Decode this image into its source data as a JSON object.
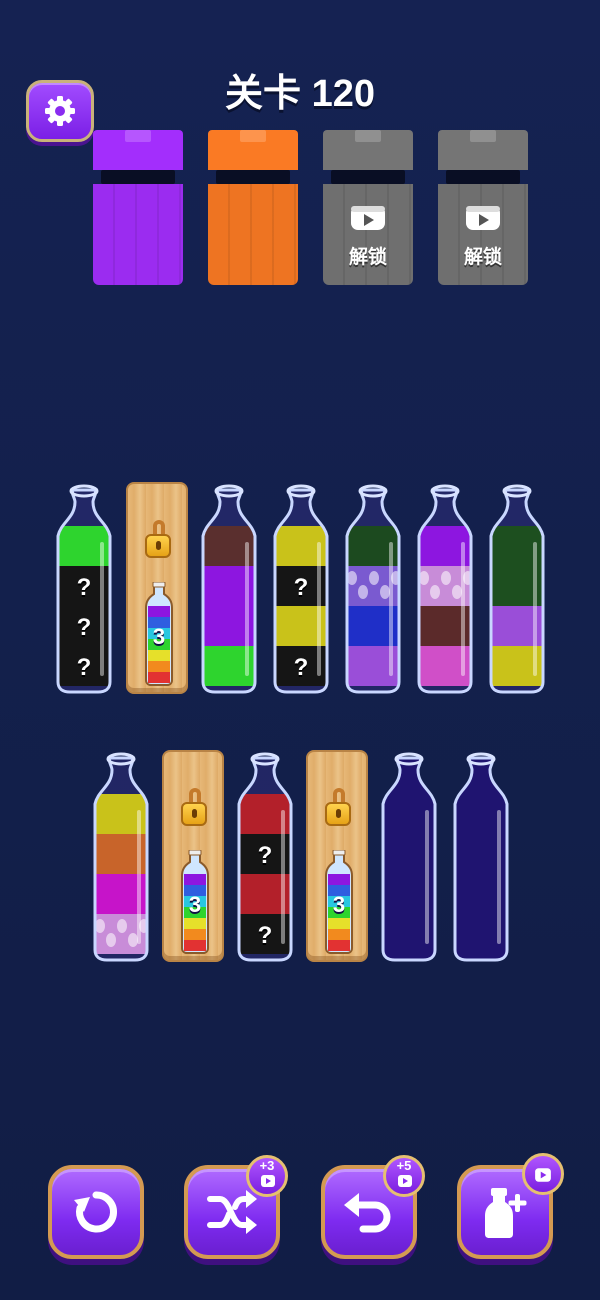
{
  "level": {
    "title": "关卡 120"
  },
  "settings": {
    "icon": "gear-icon"
  },
  "boxes": [
    {
      "color": "#9b2cf0",
      "locked": false
    },
    {
      "color": "#ee7422",
      "locked": false
    },
    {
      "color": "#6f6f6f",
      "locked": true,
      "label": "解锁",
      "icon": "video-icon"
    },
    {
      "color": "#6f6f6f",
      "locked": true,
      "label": "解锁",
      "icon": "video-icon"
    }
  ],
  "colors": {
    "green": "#2ed42e",
    "black": "#151515",
    "brown": "#5a2f2e",
    "purple": "#8d16e0",
    "yellow": "#c9c21a",
    "darkgreen": "#1c4a1f",
    "blue": "#1f2fc8",
    "lavender": "#9a4ed8",
    "pink": "#d04fc8",
    "maroon": "#5b2a2a",
    "olivegreen": "#1d4f1f",
    "orange": "#c8642a",
    "magenta": "#c614c9",
    "red": "#b3202a",
    "marbleblue": "#7a5ad0",
    "marblepink": "#c88cd8"
  },
  "row1": [
    {
      "type": "bottle",
      "layers": [
        "green",
        "black",
        "black",
        "black"
      ],
      "hidden": [
        false,
        true,
        true,
        true
      ]
    },
    {
      "type": "locked",
      "count": "3"
    },
    {
      "type": "bottle",
      "layers": [
        "brown",
        "purple",
        "purple",
        "green"
      ],
      "hidden": [
        false,
        false,
        false,
        false
      ]
    },
    {
      "type": "bottle",
      "layers": [
        "yellow",
        "black",
        "yellow",
        "black"
      ],
      "hidden": [
        false,
        true,
        false,
        true
      ]
    },
    {
      "type": "bottle",
      "layers": [
        "darkgreen",
        "marbleblue",
        "blue",
        "lavender"
      ],
      "hidden": [
        false,
        false,
        false,
        false
      ]
    },
    {
      "type": "bottle",
      "layers": [
        "purple",
        "marblepink",
        "maroon",
        "pink"
      ],
      "hidden": [
        false,
        false,
        false,
        false
      ]
    },
    {
      "type": "bottle",
      "layers": [
        "olivegreen",
        "olivegreen",
        "lavender",
        "yellow"
      ],
      "hidden": [
        false,
        false,
        false,
        false
      ]
    }
  ],
  "row2": [
    {
      "type": "bottle",
      "layers": [
        "yellow",
        "orange",
        "magenta",
        "marblepink"
      ],
      "hidden": [
        false,
        false,
        false,
        false
      ]
    },
    {
      "type": "locked",
      "count": "3"
    },
    {
      "type": "bottle",
      "layers": [
        "red",
        "black",
        "red",
        "black"
      ],
      "hidden": [
        false,
        true,
        false,
        true
      ]
    },
    {
      "type": "locked",
      "count": "3"
    },
    {
      "type": "bottle",
      "layers": [],
      "hidden": []
    },
    {
      "type": "bottle",
      "layers": [],
      "hidden": []
    }
  ],
  "hidden_mark": "?",
  "buttons": [
    {
      "name": "restart-button",
      "icon": "restart-icon"
    },
    {
      "name": "shuffle-button",
      "icon": "shuffle-icon",
      "badge": "+3",
      "badge_icon": "video-icon"
    },
    {
      "name": "undo-button",
      "icon": "undo-icon",
      "badge": "+5",
      "badge_icon": "video-icon"
    },
    {
      "name": "add-bottle-button",
      "icon": "add-bottle-icon",
      "badge": "",
      "badge_icon": "video-icon"
    }
  ]
}
